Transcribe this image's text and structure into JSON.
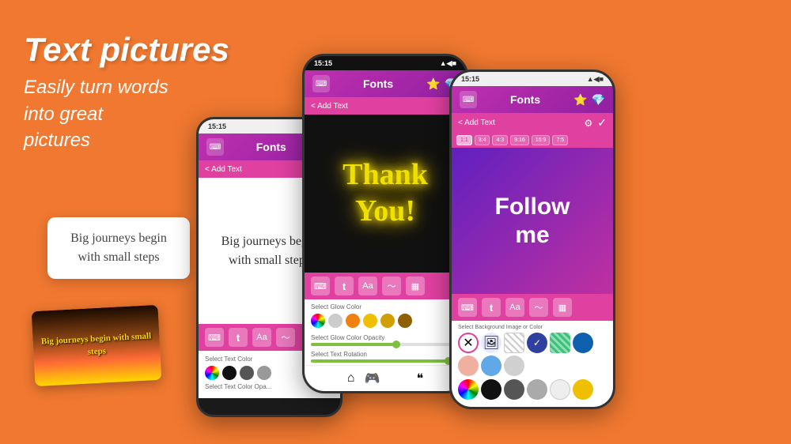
{
  "hero": {
    "title": "Text pictures",
    "subtitle_line1": "Easily turn words",
    "subtitle_line2": "into great",
    "subtitle_line3": "pictures"
  },
  "phone1": {
    "status_time": "15:15",
    "top_bar_title": "Fonts",
    "sub_bar_text": "< Add Text",
    "canvas_text": "Big journeys begin with small steps",
    "text_color_label": "Select Text Color",
    "text_color_opacity_label": "Select Text Color Opa..."
  },
  "phone2": {
    "status_time": "15:15",
    "top_bar_title": "Fonts",
    "sub_bar_text": "< Add Text",
    "canvas_text_line1": "Thank",
    "canvas_text_line2": "You!",
    "glow_color_label": "Select Glow Color",
    "glow_opacity_label": "Select Glow Color Opacity",
    "rotation_label": "Select Text Rotation"
  },
  "phone3": {
    "status_time": "15:15",
    "top_bar_title": "Fonts",
    "sub_bar_text": "< Add Text",
    "canvas_text_line1": "Follow",
    "canvas_text_line2": "me",
    "ratio_options": [
      "1:1",
      "3:4",
      "4:3",
      "9:16",
      "16:9",
      "7:5"
    ],
    "bg_label": "Select Background Image or Color"
  },
  "card_white": {
    "text": "Big journeys begin with small steps"
  },
  "card_photo": {
    "text": "Big journeys begin with small steps"
  }
}
